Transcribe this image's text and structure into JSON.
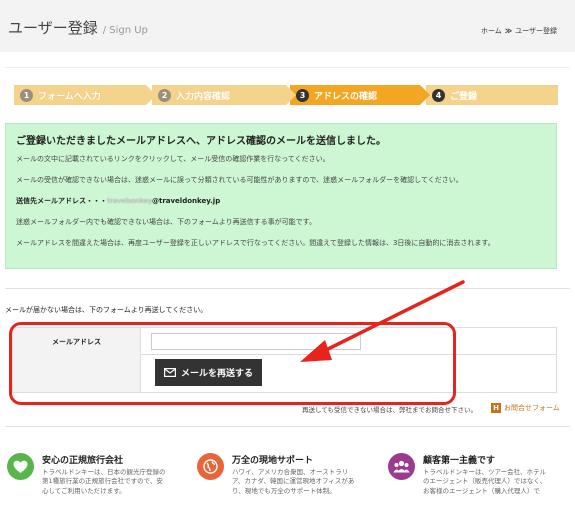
{
  "header": {
    "title": "ユーザー登録",
    "subtitle": "/ Sign Up",
    "breadcrumb": {
      "home": "ホーム",
      "separator": "≫",
      "current": "ユーザー登録"
    }
  },
  "steps": [
    {
      "num": "1",
      "label": "フォームへ入力",
      "state": "done"
    },
    {
      "num": "2",
      "label": "入力内容確認",
      "state": "done"
    },
    {
      "num": "3",
      "label": "アドレスの確認",
      "state": "active"
    },
    {
      "num": "4",
      "label": "ご登録",
      "state": "upcoming"
    }
  ],
  "notice": {
    "heading": "ご登録いただきましたメールアドレスへ、アドレス確認のメールを送信しました。",
    "p1": "メールの文中に記載されているリンクをクリックして、メール受信の確認作業を行なってください。",
    "p2": "メールの受信が確認できない場合は、迷惑メールに誤って分類されている可能性がありますので、迷惑メールフォルダーを確認してください。",
    "address_label": "送信先メールアドレス・・・",
    "address_hidden": "travelsonkey",
    "address_domain": "@traveldonkey.jp",
    "p3": "迷惑メールフォルダー内でも確認できない場合は、下のフォームより再送信する事が可能です。",
    "p4": "メールアドレスを間違えた場合は、再度ユーザー登録を正しいアドレスで行なってください。間違えて登録した情報は、3日後に自動的に消去されます。"
  },
  "resend": {
    "lead": "メールが届かない場合は、下のフォームより再送してください。",
    "email_label": "メールアドレス",
    "email_value": "",
    "button_label": "メールを再送する"
  },
  "contact": {
    "note": "再送しても受信できない場合は、弊社までお問合せ下さい。",
    "link_icon": "H",
    "link_label": "お問合せフォーム"
  },
  "features": [
    {
      "icon": "heart-icon",
      "title": "安心の正規旅行会社",
      "lines": [
        "トラベルドンキーは、日本の観光庁登録の",
        "第1種旅行業の正規旅行会社ですので、安",
        "心してご利用いただけます。"
      ]
    },
    {
      "icon": "globe-icon",
      "title": "万全の現地サポート",
      "lines": [
        "ハワイ、アメリカ合衆国、オーストラリ",
        "ア、カナダ、韓国に運営現地オフィスがあ",
        "り、現地でも万全のサポート体制。"
      ]
    },
    {
      "icon": "people-icon",
      "title": "顧客第一主義です",
      "lines": [
        "トラベルドンキーは、ツアー会社、ホテル",
        "のエージェント（販売代理人）ではなく、",
        "お客様のエージェント（購入代理人）で"
      ]
    }
  ],
  "colors": {
    "step_inactive": "#f4d38c",
    "step_active": "#f3a623",
    "notice_bg": "#cdf7d3",
    "annotation_red": "#e8231b",
    "button_dark": "#333333",
    "link_orange": "#c7711a"
  }
}
